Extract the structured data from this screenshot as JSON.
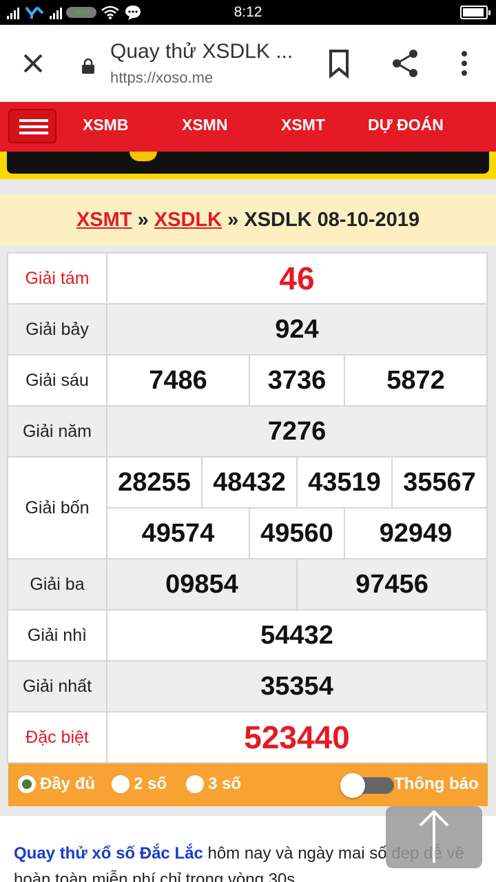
{
  "status_bar": {
    "time": "8:12",
    "carrier_badge": "viettel"
  },
  "browser": {
    "page_title": "Quay thử XSDLK ...",
    "url": "https://xoso.me"
  },
  "nav": {
    "items": [
      {
        "label": "XSMB"
      },
      {
        "label": "XSMN"
      },
      {
        "label": "XSMT"
      },
      {
        "label": "DỰ ĐOÁN"
      }
    ]
  },
  "breadcrumb": {
    "link1": "XSMT",
    "sep1": " » ",
    "link2": "XSDLK",
    "sep2": " » ",
    "current": "XSDLK 08-10-2019"
  },
  "results": {
    "giai_tam": {
      "label": "Giải tám",
      "values": [
        "46"
      ]
    },
    "giai_bay": {
      "label": "Giải bảy",
      "values": [
        "924"
      ]
    },
    "giai_sau": {
      "label": "Giải sáu",
      "values": [
        "7486",
        "3736",
        "5872"
      ]
    },
    "giai_nam": {
      "label": "Giải năm",
      "values": [
        "7276"
      ]
    },
    "giai_bon": {
      "label": "Giải bốn",
      "values": [
        "28255",
        "48432",
        "43519",
        "35567",
        "49574",
        "49560",
        "92949"
      ]
    },
    "giai_ba": {
      "label": "Giải ba",
      "values": [
        "09854",
        "97456"
      ]
    },
    "giai_nhi": {
      "label": "Giải nhì",
      "values": [
        "54432"
      ]
    },
    "giai_nhat": {
      "label": "Giải nhất",
      "values": [
        "35354"
      ]
    },
    "dac_biet": {
      "label": "Đặc biệt",
      "values": [
        "523440"
      ]
    }
  },
  "options": {
    "full": "Đầy đủ",
    "two": "2 số",
    "three": "3 số",
    "notify": "Thông báo",
    "selected": "full",
    "notify_on": false
  },
  "description": {
    "link": "Quay thử xổ số Đắc Lắc",
    "text": " hôm nay và ngày mai số đẹp dễ về hoàn toàn miễn phí chỉ trong vòng 30s"
  },
  "colors": {
    "brand_red": "#e41b24",
    "options_orange": "#f7a233",
    "breadcrumb_bg": "#fcf0c2",
    "link_blue": "#1a3cc8"
  }
}
